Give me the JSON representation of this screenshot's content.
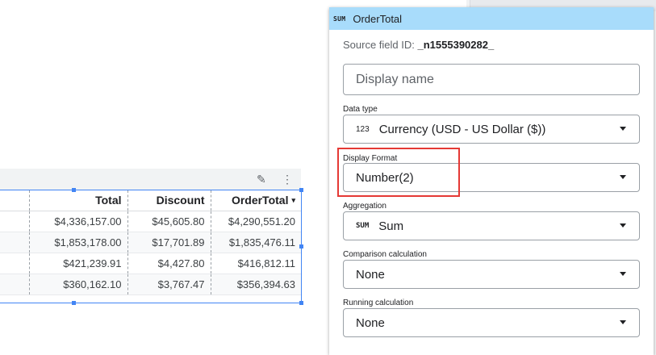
{
  "table": {
    "headers": [
      "",
      "Total",
      "Discount",
      "OrderTotal"
    ],
    "sort_indicator": "▾",
    "rows": [
      [
        "",
        "$4,336,157.00",
        "$45,605.80",
        "$4,290,551.20"
      ],
      [
        "",
        "$1,853,178.00",
        "$17,701.89",
        "$1,835,476.11"
      ],
      [
        "",
        "$421,239.91",
        "$4,427.80",
        "$416,812.11"
      ],
      [
        "",
        "$360,162.10",
        "$3,767.47",
        "$356,394.63"
      ]
    ],
    "toolbar": {
      "edit_icon": "✎",
      "more_icon": "⋮"
    }
  },
  "panel": {
    "header": {
      "tag": "SUM",
      "title": "OrderTotal"
    },
    "source_label": "Source field ID:",
    "source_id": "_n1555390282_",
    "display_name_placeholder": "Display name",
    "data_type": {
      "label": "Data type",
      "icon": "123",
      "value": "Currency (USD - US Dollar ($))"
    },
    "display_format": {
      "label": "Display Format",
      "value": "Number(2)"
    },
    "aggregation": {
      "label": "Aggregation",
      "icon": "SUM",
      "value": "Sum"
    },
    "comparison": {
      "label": "Comparison calculation",
      "value": "None"
    },
    "running": {
      "label": "Running calculation",
      "value": "None"
    }
  },
  "colors": {
    "header_bg": "#a8dcfb",
    "selection": "#4285f4",
    "highlight": "#e53935"
  }
}
